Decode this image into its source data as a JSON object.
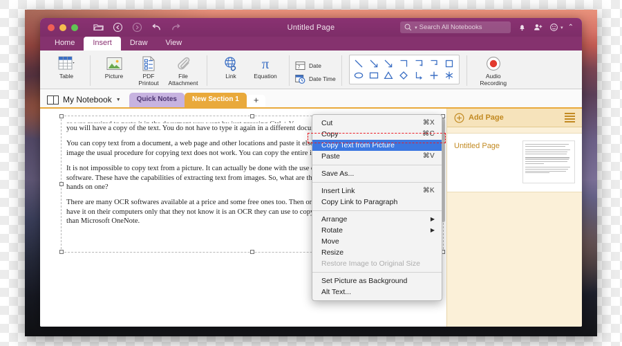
{
  "window": {
    "title": "Untitled Page",
    "traffic_lights": [
      "close-red",
      "minimize-yellow",
      "zoom-green"
    ],
    "toolbar_icons": [
      "open-folder-icon",
      "back-icon",
      "forward-icon",
      "undo-icon",
      "redo-icon"
    ]
  },
  "search": {
    "placeholder": "Search All Notebooks",
    "icon": "search-icon"
  },
  "titlebar_right_icons": [
    "bell-icon",
    "add-person-icon",
    "smiley-icon",
    "chevron-up-icon"
  ],
  "ribbon": {
    "tabs": [
      {
        "label": "Home",
        "active": false
      },
      {
        "label": "Insert",
        "active": true
      },
      {
        "label": "Draw",
        "active": false
      },
      {
        "label": "View",
        "active": false
      }
    ],
    "items": [
      {
        "label": "Table",
        "icon": "table-icon"
      },
      {
        "label": "Picture",
        "icon": "picture-icon"
      },
      {
        "label": "PDF\nPrintout",
        "icon": "pdf-printout-icon"
      },
      {
        "label": "File\nAttachment",
        "icon": "paperclip-icon"
      },
      {
        "label": "Link",
        "icon": "link-globe-icon"
      },
      {
        "label": "Equation",
        "icon": "pi-icon"
      }
    ],
    "date_buttons": [
      {
        "label": "Date",
        "icon": "calendar-icon"
      },
      {
        "label": "Date  Time",
        "icon": "calendar-clock-icon"
      }
    ],
    "shapes_gallery": {
      "row1": [
        "line-diagonal",
        "arrow-diagonal",
        "arrow-diagonal-2",
        "elbow-connector",
        "elbow-arrow",
        "elbow-arrow-2",
        "rectangle-connector"
      ],
      "row2": [
        "ellipse",
        "rectangle",
        "triangle",
        "diamond",
        "corner-arrow",
        "plus-cross",
        "asterisk"
      ]
    },
    "audio": {
      "label": "Audio\nRecording",
      "icon": "record-icon"
    }
  },
  "notebook_bar": {
    "notebook_name": "My Notebook",
    "notebook_icon": "notebook-icon",
    "sections": [
      {
        "label": "Quick Notes",
        "active": false
      },
      {
        "label": "New Section 1",
        "active": true
      }
    ],
    "add_section_label": "+"
  },
  "document": {
    "paragraph_clipped": "as was required to paste it in the document you want by just pressing Ctrl + V",
    "paragraphs": [
      "you will have a copy of the text. You do not have to type it again in a different document. It makes life so much easier.",
      "You can copy text from a document, a web page and other locations and paste it elsewhere but when you are dealing with an image the usual procedure for copying text does not work. You can copy the entire image but not a chunk of text from it.",
      "It is not impossible to copy text from a picture. It can actually be done with the use of Optical Character Recognition (OCR) software. These have the capabilities of extracting text from images. So, what are these softwares and how can you get your hands on one?",
      "There are many OCR softwares available at a price and some free ones too. Then one that is very common and many people have it on their computers only that they not know it is an OCR they can use to copy text from pictures. This is none other than Microsoft OneNote."
    ]
  },
  "context_menu": {
    "groups": [
      [
        {
          "label": "Cut",
          "shortcut": "⌘X",
          "state": "normal"
        },
        {
          "label": "Copy",
          "shortcut": "⌘C",
          "state": "normal"
        },
        {
          "label": "Copy Text from Picture",
          "shortcut": "",
          "state": "selected"
        },
        {
          "label": "Paste",
          "shortcut": "⌘V",
          "state": "normal"
        }
      ],
      [
        {
          "label": "Save As...",
          "shortcut": "",
          "state": "normal"
        }
      ],
      [
        {
          "label": "Insert Link",
          "shortcut": "⌘K",
          "state": "normal"
        },
        {
          "label": "Copy Link to Paragraph",
          "shortcut": "",
          "state": "normal"
        }
      ],
      [
        {
          "label": "Arrange",
          "shortcut": "▶",
          "state": "submenu"
        },
        {
          "label": "Rotate",
          "shortcut": "▶",
          "state": "submenu"
        },
        {
          "label": "Move",
          "shortcut": "",
          "state": "normal"
        },
        {
          "label": "Resize",
          "shortcut": "",
          "state": "normal"
        },
        {
          "label": "Restore Image to Original Size",
          "shortcut": "",
          "state": "disabled"
        }
      ],
      [
        {
          "label": "Set Picture as Background",
          "shortcut": "",
          "state": "normal"
        },
        {
          "label": "Alt Text...",
          "shortcut": "",
          "state": "normal"
        }
      ]
    ],
    "highlight_color": "#3c77e0",
    "annotation_color": "#ea1c24"
  },
  "pages_panel": {
    "add_page_label": "Add Page",
    "add_page_icon": "plus-circle-icon",
    "menu_icon": "hamburger-icon",
    "pages": [
      {
        "title": "Untitled Page",
        "thumbnail": "page-thumbnail"
      }
    ]
  },
  "colors": {
    "brand_purple": "#85326e",
    "section_orange": "#e9a93b",
    "panel_cream": "#fbf0d8"
  }
}
